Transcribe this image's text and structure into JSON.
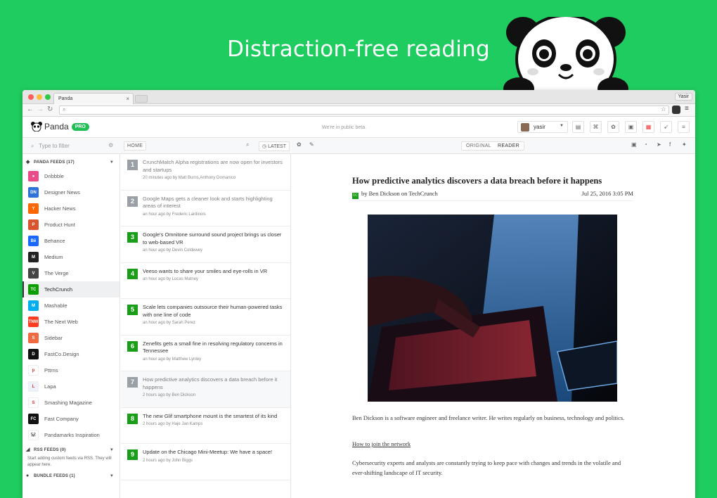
{
  "headline": "Distraction-free reading",
  "browser": {
    "tab_title": "Panda",
    "tab_close": "×",
    "profile": "Yasir",
    "address": ""
  },
  "app": {
    "name": "Panda",
    "badge": "PRO",
    "beta_note": "We're in public beta.",
    "user": "yasir",
    "search_placeholder": "Type to filter",
    "home_label": "HOME",
    "latest_label": "LATEST",
    "original_label": "ORIGINAL",
    "reader_label": "READER"
  },
  "sidebar": {
    "panda_feeds_label": "PANDA FEEDS (17)",
    "feeds": [
      {
        "label": "Dribbble",
        "abbr": "●",
        "color": "#ea4c89"
      },
      {
        "label": "Designer News",
        "abbr": "DN",
        "color": "#2d72d9"
      },
      {
        "label": "Hacker News",
        "abbr": "Y",
        "color": "#ff6600"
      },
      {
        "label": "Product Hunt",
        "abbr": "P",
        "color": "#da552f"
      },
      {
        "label": "Behance",
        "abbr": "Bē",
        "color": "#1769ff"
      },
      {
        "label": "Medium",
        "abbr": "M",
        "color": "#222222"
      },
      {
        "label": "The Verge",
        "abbr": "V",
        "color": "#444444"
      },
      {
        "label": "TechCrunch",
        "abbr": "TC",
        "color": "#0a9e01"
      },
      {
        "label": "Mashable",
        "abbr": "M",
        "color": "#00aeef"
      },
      {
        "label": "The Next Web",
        "abbr": "TNW",
        "color": "#ff3c1f"
      },
      {
        "label": "Sidebar",
        "abbr": "S",
        "color": "#ef6a41"
      },
      {
        "label": "FastCo.Design",
        "abbr": "D",
        "color": "#111111"
      },
      {
        "label": "Pttrns",
        "abbr": "p",
        "color": "#ffffff"
      },
      {
        "label": "Lapa",
        "abbr": "L",
        "color": "#eef2fb"
      },
      {
        "label": "Smashing Magazine",
        "abbr": "S",
        "color": "#ffffff"
      },
      {
        "label": "Fast Company",
        "abbr": "FC",
        "color": "#111111"
      },
      {
        "label": "Pandamarks Inspiration",
        "abbr": "🐼",
        "color": "#ffffff"
      }
    ],
    "rss_label": "RSS FEEDS (0)",
    "rss_note": "Start adding custom feeds via RSS. They will appear here.",
    "bundle_label": "BUNDLE FEEDS (1)"
  },
  "articles": [
    {
      "num": "1",
      "title": "CrunchMatch Alpha registrations are now open for investors and startups",
      "meta": "20 minutes ago by Matt Burns,Anthony Domanico",
      "state": "read"
    },
    {
      "num": "2",
      "title": "Google Maps gets a cleaner look and starts highlighting areas of interest",
      "meta": "an hour ago by Frederic Lardinois",
      "state": "read"
    },
    {
      "num": "3",
      "title": "Google's Omnitone surround sound project brings us closer to web-based VR",
      "meta": "an hour ago by Devin Coldewey",
      "state": "new"
    },
    {
      "num": "4",
      "title": "Veeso wants to share your smiles and eye-rolls in VR",
      "meta": "an hour ago by Lucas Matney",
      "state": "new"
    },
    {
      "num": "5",
      "title": "Scale lets companies outsource their human-powered tasks with one line of code",
      "meta": "an hour ago by Sarah Perez",
      "state": "new"
    },
    {
      "num": "6",
      "title": "Zenefits gets a small fine in resolving regulatory concerns in Tennessee",
      "meta": "an hour ago by Matthew Lynley",
      "state": "new"
    },
    {
      "num": "7",
      "title": "How predictive analytics discovers a data breach before it happens",
      "meta": "2 hours ago by Ben Dickson",
      "state": "selected"
    },
    {
      "num": "8",
      "title": "The new Glif smartphone mount is the smartest of its kind",
      "meta": "2 hours ago by Haje Jan Kamps",
      "state": "new"
    },
    {
      "num": "9",
      "title": "Update on the Chicago Mini-Meetup: We have a space!",
      "meta": "2 hours ago by John Biggs",
      "state": "new"
    }
  ],
  "article": {
    "title": "How predictive analytics discovers a data breach before it happens",
    "byline": "by Ben Dickson on TechCrunch",
    "date": "Jul 25, 2016 3:05 PM",
    "p1": "Ben Dickson is a software engineer and freelance writer. He writes regularly on business, technology and politics.",
    "link": "How to join the network",
    "p2": "Cybersecurity experts and analysts are constantly trying to keep pace with changes and trends in the volatile and ever-shifting landscape of IT security."
  }
}
